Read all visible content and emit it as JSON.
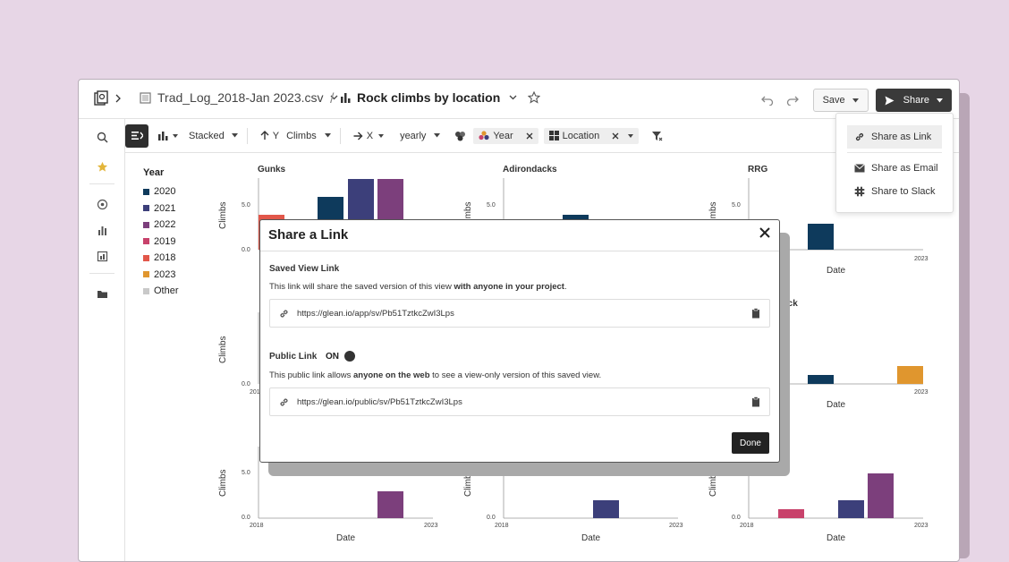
{
  "file_name": "Trad_Log_2018-Jan 2023.csv",
  "view_title": "Rock climbs by location",
  "save_label": "Save",
  "share_label": "Share",
  "toolbar": {
    "stack_mode": "Stacked",
    "y_label": "Y",
    "y_value": "Climbs",
    "x_label": "X",
    "x_value": "yearly",
    "color_chip": "Year",
    "facet_chip": "Location"
  },
  "legend": {
    "title": "Year",
    "items": [
      {
        "label": "2020",
        "color": "#0e3a5c"
      },
      {
        "label": "2021",
        "color": "#3c3f7a"
      },
      {
        "label": "2022",
        "color": "#7c3f7c"
      },
      {
        "label": "2019",
        "color": "#c8426b"
      },
      {
        "label": "2018",
        "color": "#e2574a"
      },
      {
        "label": "2023",
        "color": "#e0962e"
      },
      {
        "label": "Other",
        "color": "#c9c9c9"
      }
    ]
  },
  "facets": {
    "gunks": "Gunks",
    "adirondacks": "Adirondacks",
    "rrg": "RRG",
    "row2_right_partial": "s Rock"
  },
  "axis": {
    "y_title": "Climbs",
    "x_title": "Date",
    "tick_5": "5.0",
    "tick_0": "0.0",
    "x_start": "2018",
    "x_end": "2023"
  },
  "share_menu": {
    "link": "Share as Link",
    "email": "Share as Email",
    "slack": "Share to Slack"
  },
  "modal": {
    "title": "Share a Link",
    "saved_title": "Saved View Link",
    "saved_desc_1": "This link will share the saved version of this view ",
    "saved_desc_bold": "with anyone in your project",
    "saved_desc_2": ".",
    "saved_url": "https://glean.io/app/sv/Pb51TztkcZwI3Lps",
    "public_title": "Public Link",
    "public_toggle": "ON",
    "public_desc_1": "This public link allows ",
    "public_desc_bold": "anyone on the web",
    "public_desc_2": " to see a view-only version of this saved view.",
    "public_url": "https://glean.io/public/sv/Pb51TztkcZwI3Lps",
    "done": "Done"
  }
}
